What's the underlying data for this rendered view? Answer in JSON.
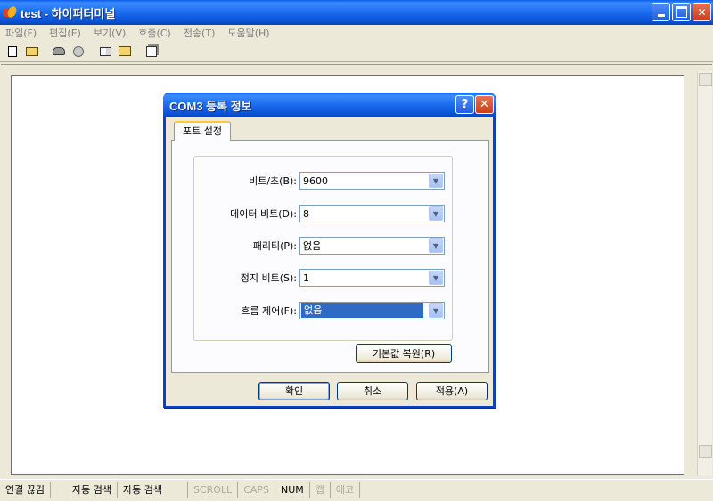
{
  "window": {
    "title": "test - 하이퍼터미널"
  },
  "menu": {
    "items": [
      "파일(F)",
      "편집(E)",
      "보기(V)",
      "호출(C)",
      "전송(T)",
      "도움말(H)"
    ]
  },
  "toolbar": {
    "icons": [
      "new-file-icon",
      "open-folder-icon",
      "call-phone-icon",
      "disconnect-icon",
      "send-file-icon",
      "receive-file-icon",
      "properties-icon"
    ]
  },
  "dialog": {
    "title": "COM3 등록 정보",
    "help_label": "?",
    "close_label": "✕",
    "tab_label": "포트 설정",
    "fields": [
      {
        "label": "비트/초(B):",
        "value": "9600"
      },
      {
        "label": "데이터 비트(D):",
        "value": "8"
      },
      {
        "label": "패리티(P):",
        "value": "없음"
      },
      {
        "label": "정지 비트(S):",
        "value": "1"
      },
      {
        "label": "흐름 제어(F):",
        "value": "없음"
      }
    ],
    "restore_defaults_label": "기본값 복원(R)",
    "ok_label": "확인",
    "cancel_label": "취소",
    "apply_label": "적용(A)"
  },
  "statusbar": {
    "connection": "연결 끊김",
    "detect1": "자동 검색",
    "detect2": "자동 검색",
    "scroll": "SCROLL",
    "caps": "CAPS",
    "num": "NUM",
    "capture": "캡",
    "echo": "에코"
  },
  "colors": {
    "title_bar": "#1f6ef2",
    "close_button": "#d4532e",
    "selection": "#316ac5",
    "tab_highlight": "#ffc83c"
  }
}
